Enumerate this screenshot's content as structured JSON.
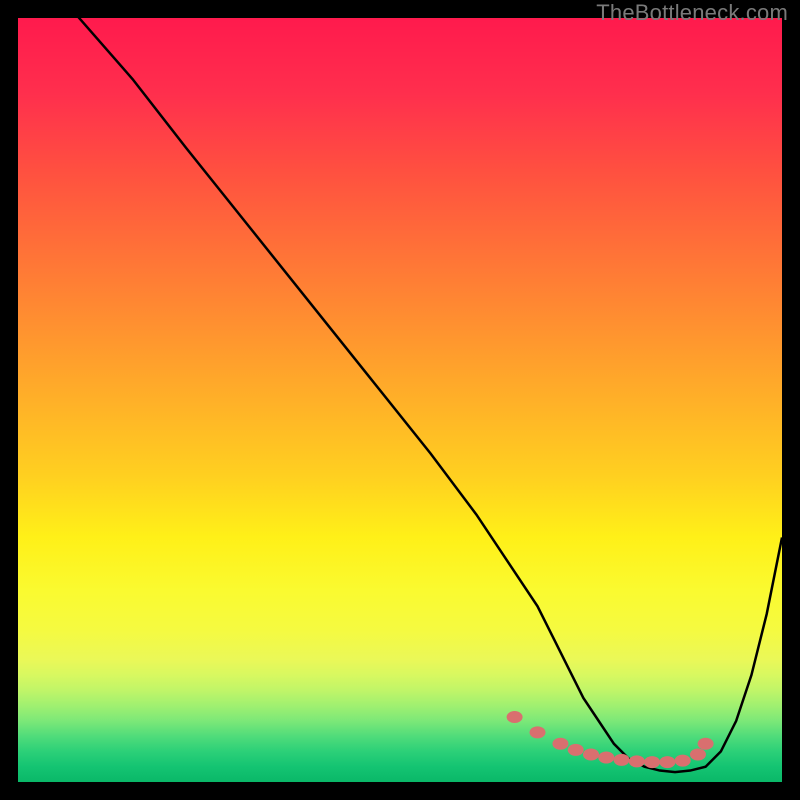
{
  "watermark": "TheBottleneck.com",
  "chart_data": {
    "type": "line",
    "title": "",
    "xlabel": "",
    "ylabel": "",
    "xlim": [
      0,
      100
    ],
    "ylim": [
      0,
      100
    ],
    "x": [
      0,
      8,
      15,
      22,
      30,
      38,
      46,
      54,
      60,
      64,
      68,
      70,
      72,
      74,
      76,
      78,
      80,
      82,
      84,
      86,
      88,
      90,
      92,
      94,
      96,
      98,
      100
    ],
    "y": [
      110,
      100,
      92,
      83,
      73,
      63,
      53,
      43,
      35,
      29,
      23,
      19,
      15,
      11,
      8,
      5,
      3,
      2,
      1.5,
      1.3,
      1.5,
      2,
      4,
      8,
      14,
      22,
      32
    ],
    "markers": {
      "x": [
        65,
        68,
        71,
        73,
        75,
        77,
        79,
        81,
        83,
        85,
        87,
        89,
        90
      ],
      "y": [
        8.5,
        6.5,
        5.0,
        4.2,
        3.6,
        3.2,
        2.9,
        2.7,
        2.6,
        2.6,
        2.8,
        3.6,
        5.0
      ]
    },
    "gradient_keyframes": [
      {
        "pos": 0.0,
        "color": "#ff1a4d"
      },
      {
        "pos": 0.1,
        "color": "#ff2f4d"
      },
      {
        "pos": 0.2,
        "color": "#ff5040"
      },
      {
        "pos": 0.3,
        "color": "#ff7038"
      },
      {
        "pos": 0.4,
        "color": "#ff9030"
      },
      {
        "pos": 0.5,
        "color": "#ffb028"
      },
      {
        "pos": 0.6,
        "color": "#ffd020"
      },
      {
        "pos": 0.68,
        "color": "#fff018"
      },
      {
        "pos": 0.75,
        "color": "#fafa30"
      },
      {
        "pos": 0.8,
        "color": "#f5fa40"
      },
      {
        "pos": 0.84,
        "color": "#eaf858"
      },
      {
        "pos": 0.86,
        "color": "#d8f860"
      },
      {
        "pos": 0.88,
        "color": "#c0f568"
      },
      {
        "pos": 0.9,
        "color": "#a0f070"
      },
      {
        "pos": 0.92,
        "color": "#7ce878"
      },
      {
        "pos": 0.94,
        "color": "#50dc7a"
      },
      {
        "pos": 0.96,
        "color": "#2cd078"
      },
      {
        "pos": 0.98,
        "color": "#14c472"
      },
      {
        "pos": 1.0,
        "color": "#0ab868"
      }
    ],
    "marker_color": "#d96f6f",
    "curve_color": "#000000"
  }
}
